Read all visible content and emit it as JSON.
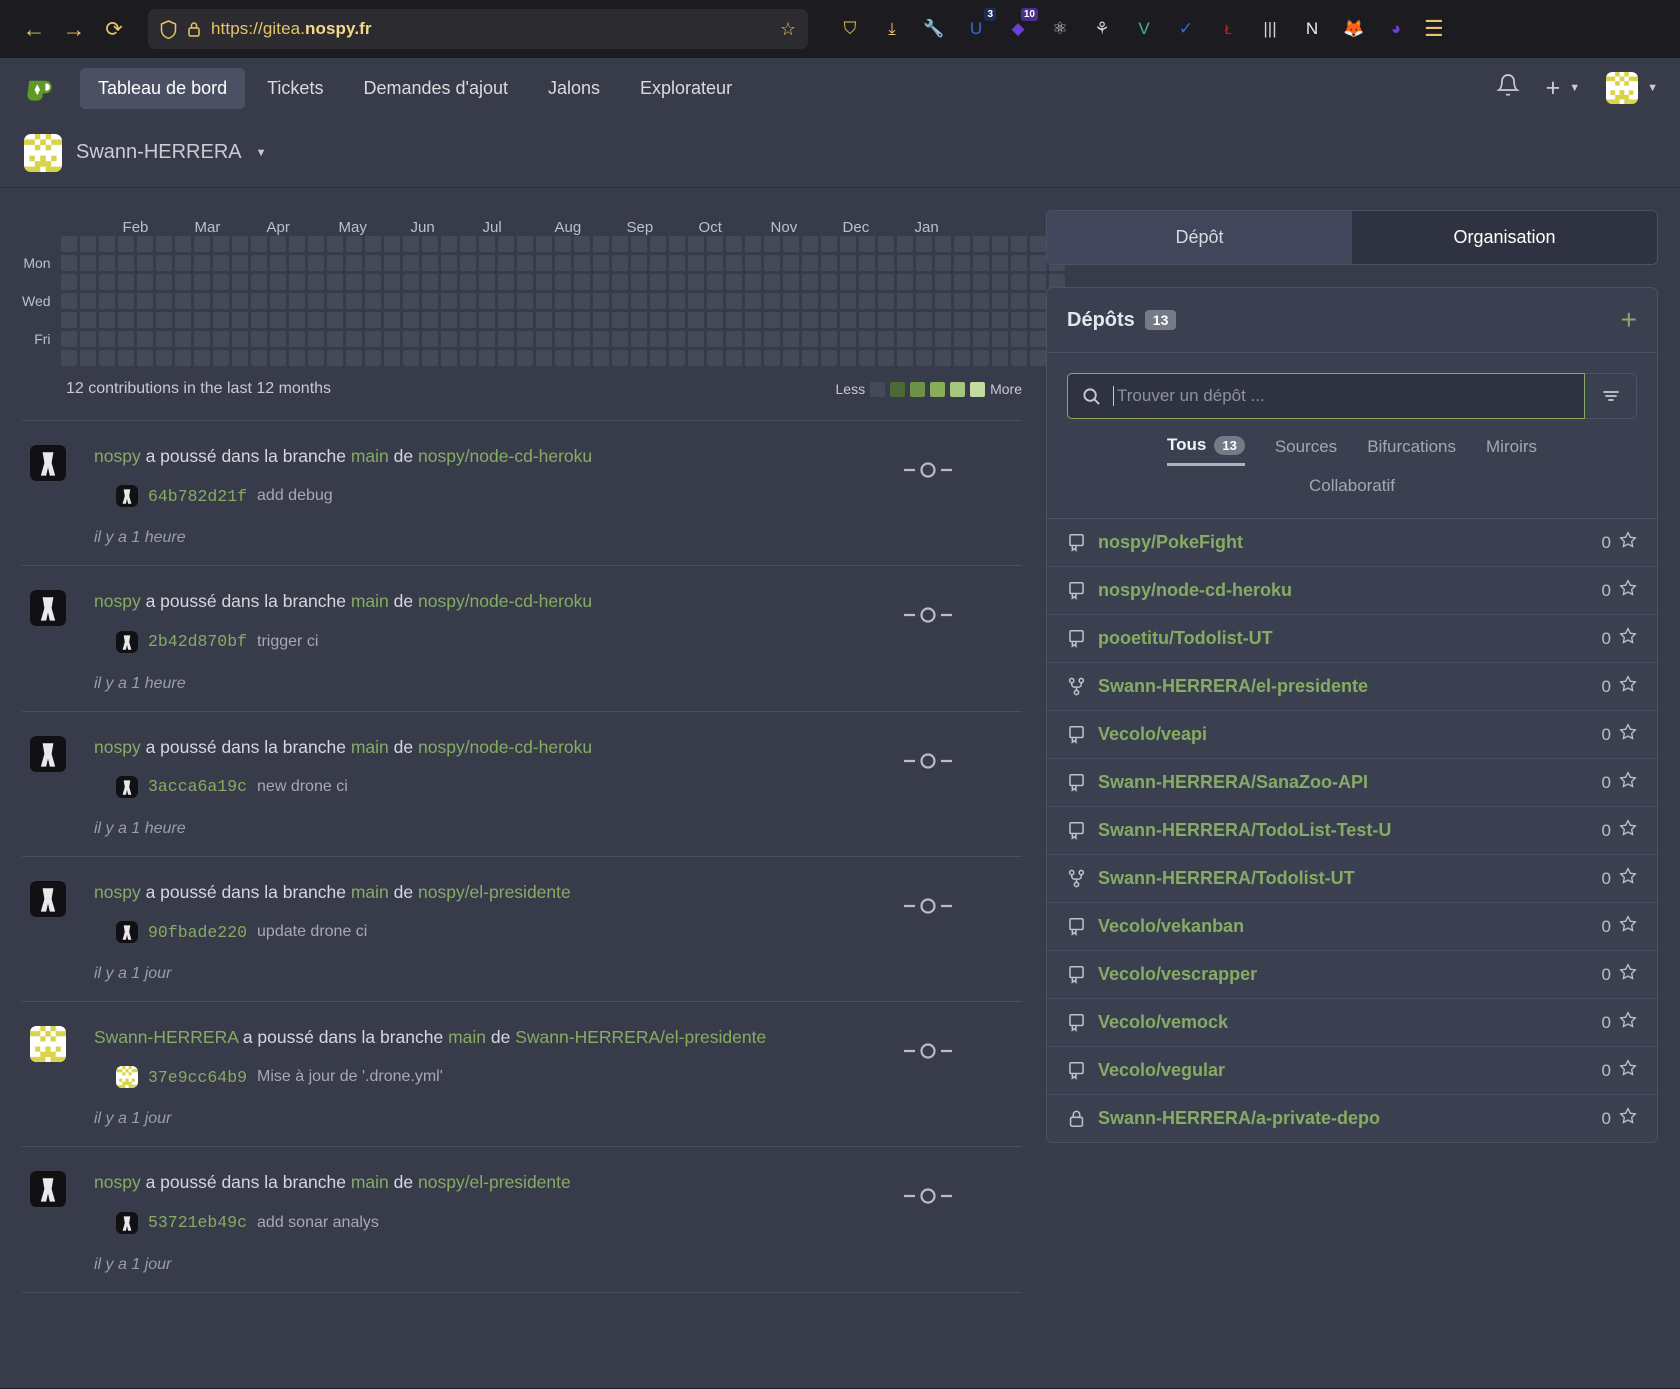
{
  "browser": {
    "back_icon": "arrow-left-icon",
    "forward_icon": "arrow-right-icon",
    "reload_icon": "reload-icon",
    "url_prefix": "https://gitea.",
    "url_domain": "nospy.fr",
    "bookmark_icon": "star-icon",
    "extensions": [
      {
        "name": "pocket-extension",
        "glyph": "⛉",
        "color": "#e8c468",
        "badge": ""
      },
      {
        "name": "downloads-button",
        "glyph": "⤓",
        "color": "#e8c468",
        "badge": ""
      },
      {
        "name": "wrench-extension",
        "glyph": "🔧",
        "color": "#e8c468",
        "badge": ""
      },
      {
        "name": "vimium-extension",
        "glyph": "U",
        "color": "#2f6fd0",
        "badge": "3"
      },
      {
        "name": "purple-extension",
        "glyph": "◆",
        "color": "#6d3fd4",
        "badge": "10"
      },
      {
        "name": "react-devtools-extension",
        "glyph": "⚛",
        "color": "#cfd3da",
        "badge": ""
      },
      {
        "name": "graph-extension",
        "glyph": "⚘",
        "color": "#cfd3da",
        "badge": ""
      },
      {
        "name": "vue-devtools-extension",
        "glyph": "V",
        "color": "#41b883",
        "badge": ""
      },
      {
        "name": "blue-check-extension",
        "glyph": "✓",
        "color": "#2f6fd0",
        "badge": ""
      },
      {
        "name": "lastpass-extension",
        "glyph": "ᴌ",
        "color": "#a62a2a",
        "badge": ""
      },
      {
        "name": "grid-extension",
        "glyph": "|||",
        "color": "#cfd3da",
        "badge": ""
      },
      {
        "name": "notion-extension",
        "glyph": "N",
        "color": "#e9ecef",
        "badge": ""
      },
      {
        "name": "firefox-account-icon",
        "glyph": "🦊",
        "color": "#e07b39",
        "badge": ""
      },
      {
        "name": "ghost-extension",
        "glyph": "◕",
        "color": "#6d3fd4",
        "badge": ""
      }
    ],
    "menu_icon": "hamburger-menu-icon"
  },
  "nav": {
    "logo": "gitea-logo",
    "items": [
      {
        "label": "Tableau de bord",
        "active": true
      },
      {
        "label": "Tickets",
        "active": false
      },
      {
        "label": "Demandes d'ajout",
        "active": false
      },
      {
        "label": "Jalons",
        "active": false
      },
      {
        "label": "Explorateur",
        "active": false
      }
    ],
    "bell_icon": "notification-bell-icon",
    "plus_icon": "create-new-icon",
    "avatar_icon": "user-avatar"
  },
  "owner": {
    "name": "Swann-HERRERA",
    "avatar": "owner-avatar"
  },
  "heatmap": {
    "months": [
      "Feb",
      "Mar",
      "Apr",
      "May",
      "Jun",
      "Jul",
      "Aug",
      "Sep",
      "Oct",
      "Nov",
      "Dec",
      "Jan"
    ],
    "day_labels": [
      "",
      "Mon",
      "",
      "Wed",
      "",
      "Fri",
      ""
    ],
    "summary": "12 contributions in the last 12 months",
    "legend_less": "Less",
    "legend_more": "More",
    "legend_colors": [
      "#454a5a",
      "#4c6a35",
      "#6f9147",
      "#88ae56",
      "#a6c57e",
      "#c3daa0"
    ],
    "empty_color": "#454a5a",
    "weeks": 53,
    "active_cells": [
      {
        "week": 52,
        "day": 0,
        "level": 4
      },
      {
        "week": 52,
        "day": 3,
        "level": 4
      },
      {
        "week": 52,
        "day": 5,
        "level": 3
      },
      {
        "week": 52,
        "day": 6,
        "level": 4
      }
    ]
  },
  "feed": [
    {
      "actor": "nospy",
      "actor_avatar": "dark",
      "action_mid": " a poussé dans la branche ",
      "branch": "main",
      "action_end": " de ",
      "repo": "nospy/node-cd-heroku",
      "commit_sha": "64b782d21f",
      "commit_msg": "add debug",
      "time": "il y a 1 heure"
    },
    {
      "actor": "nospy",
      "actor_avatar": "dark",
      "action_mid": " a poussé dans la branche ",
      "branch": "main",
      "action_end": " de ",
      "repo": "nospy/node-cd-heroku",
      "commit_sha": "2b42d870bf",
      "commit_msg": "trigger ci",
      "time": "il y a 1 heure"
    },
    {
      "actor": "nospy",
      "actor_avatar": "dark",
      "action_mid": " a poussé dans la branche ",
      "branch": "main",
      "action_end": " de ",
      "repo": "nospy/node-cd-heroku",
      "commit_sha": "3acca6a19c",
      "commit_msg": "new drone ci",
      "time": "il y a 1 heure"
    },
    {
      "actor": "nospy",
      "actor_avatar": "dark",
      "action_mid": " a poussé dans la branche ",
      "branch": "main",
      "action_end": " de ",
      "repo": "nospy/el-presidente",
      "commit_sha": "90fbade220",
      "commit_msg": "update drone ci",
      "time": "il y a 1 jour"
    },
    {
      "actor": "Swann-HERRERA",
      "actor_avatar": "yellow",
      "action_mid": " a poussé dans la branche ",
      "branch": "main",
      "action_end": " de ",
      "repo": "Swann-HERRERA/el-presidente",
      "commit_sha": "37e9cc64b9",
      "commit_msg": "Mise à jour de '.drone.yml'",
      "time": "il y a 1 jour"
    },
    {
      "actor": "nospy",
      "actor_avatar": "dark",
      "action_mid": " a poussé dans la branche ",
      "branch": "main",
      "action_end": " de ",
      "repo": "nospy/el-presidente",
      "commit_sha": "53721eb49c",
      "commit_msg": "add sonar analys",
      "time": "il y a 1 jour"
    }
  ],
  "side": {
    "seg_tabs": [
      {
        "label": "Dépôt",
        "active": false
      },
      {
        "label": "Organisation",
        "active": true
      }
    ],
    "panel_title": "Dépôts",
    "panel_count": "13",
    "add_icon": "plus-icon",
    "search_placeholder": "Trouver un dépôt ...",
    "search_value": "",
    "search_icon": "search-icon",
    "filter_icon": "filter-icon",
    "filter_tabs": [
      {
        "label": "Tous",
        "count": "13",
        "active": true
      },
      {
        "label": "Sources",
        "count": "",
        "active": false
      },
      {
        "label": "Bifurcations",
        "count": "",
        "active": false
      },
      {
        "label": "Miroirs",
        "count": "",
        "active": false
      }
    ],
    "filter_tabs2": [
      {
        "label": "Collaboratif",
        "count": "",
        "active": false
      }
    ],
    "repos": [
      {
        "name": "nospy/PokeFight",
        "icon": "repo-icon",
        "stars": "0"
      },
      {
        "name": "nospy/node-cd-heroku",
        "icon": "repo-icon",
        "stars": "0"
      },
      {
        "name": "pooetitu/Todolist-UT",
        "icon": "repo-icon",
        "stars": "0"
      },
      {
        "name": "Swann-HERRERA/el-presidente",
        "icon": "repo-forked-icon",
        "stars": "0"
      },
      {
        "name": "Vecolo/veapi",
        "icon": "repo-icon",
        "stars": "0"
      },
      {
        "name": "Swann-HERRERA/SanaZoo-API",
        "icon": "repo-icon",
        "stars": "0"
      },
      {
        "name": "Swann-HERRERA/TodoList-Test-U",
        "icon": "repo-icon",
        "stars": "0"
      },
      {
        "name": "Swann-HERRERA/Todolist-UT",
        "icon": "repo-forked-icon",
        "stars": "0"
      },
      {
        "name": "Vecolo/vekanban",
        "icon": "repo-icon",
        "stars": "0"
      },
      {
        "name": "Vecolo/vescrapper",
        "icon": "repo-icon",
        "stars": "0"
      },
      {
        "name": "Vecolo/vemock",
        "icon": "repo-icon",
        "stars": "0"
      },
      {
        "name": "Vecolo/vegular",
        "icon": "repo-icon",
        "stars": "0"
      },
      {
        "name": "Swann-HERRERA/a-private-depo",
        "icon": "lock-icon",
        "stars": "0"
      }
    ]
  },
  "colors": {
    "accent_green": "#87ab63",
    "header_bg": "#383c4a",
    "panel_bg": "#3b4050",
    "url_yellow": "#e8c468"
  }
}
